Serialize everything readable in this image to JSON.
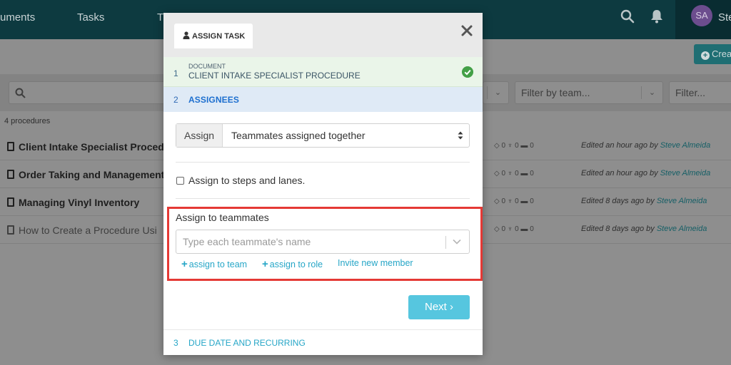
{
  "background": {
    "nav": {
      "documents": "uments",
      "tasks": "Tasks",
      "clipped": "T"
    },
    "user": {
      "initials": "SA",
      "name": "Ste"
    },
    "create_label": "Crea",
    "filters": {
      "team": "Filter by team...",
      "other": "Filter..."
    },
    "procedures_count": "4 procedures",
    "procedures": [
      {
        "title": "Client Intake Specialist Procedu",
        "meta": "◇ 0   ♆ 0   ▬ 0",
        "edited": "Edited an hour ago by",
        "user": "Steve Almeida"
      },
      {
        "title": "Order Taking and Management",
        "meta": "◇ 0   ♆ 0   ▬ 0",
        "edited": "Edited an hour ago by",
        "user": "Steve Almeida"
      },
      {
        "title": "Managing Vinyl Inventory",
        "meta": "◇ 0   ♆ 0   ▬ 0",
        "edited": "Edited 8 days ago by",
        "user": "Steve Almeida"
      },
      {
        "title": "How to Create a Procedure Usi",
        "meta": "◇ 0   ♆ 0   ▬ 0",
        "edited": "Edited 8 days ago by",
        "user": "Steve Almeida"
      }
    ]
  },
  "modal": {
    "tab_label": "ASSIGN TASK",
    "steps": {
      "document": {
        "number": "1",
        "sublabel": "DOCUMENT",
        "title": "CLIENT INTAKE SPECIALIST PROCEDURE"
      },
      "assignees": {
        "number": "2",
        "title": "ASSIGNEES"
      },
      "due": {
        "number": "3",
        "title": "DUE DATE AND RECURRING"
      }
    },
    "assign_addon": "Assign",
    "assign_mode": "Teammates assigned together",
    "checkbox_label": "Assign to steps and lanes.",
    "teammates_label": "Assign to teammates",
    "teammates_placeholder": "Type each teammate's name",
    "links": {
      "team": "assign to team",
      "role": "assign to role",
      "invite": "Invite new member"
    },
    "plus": "+",
    "next_label": "Next ›"
  },
  "colors": {
    "accent": "#26a6c7",
    "next_button": "#56c6df",
    "highlight_border": "#e53935",
    "success": "#43a047"
  }
}
